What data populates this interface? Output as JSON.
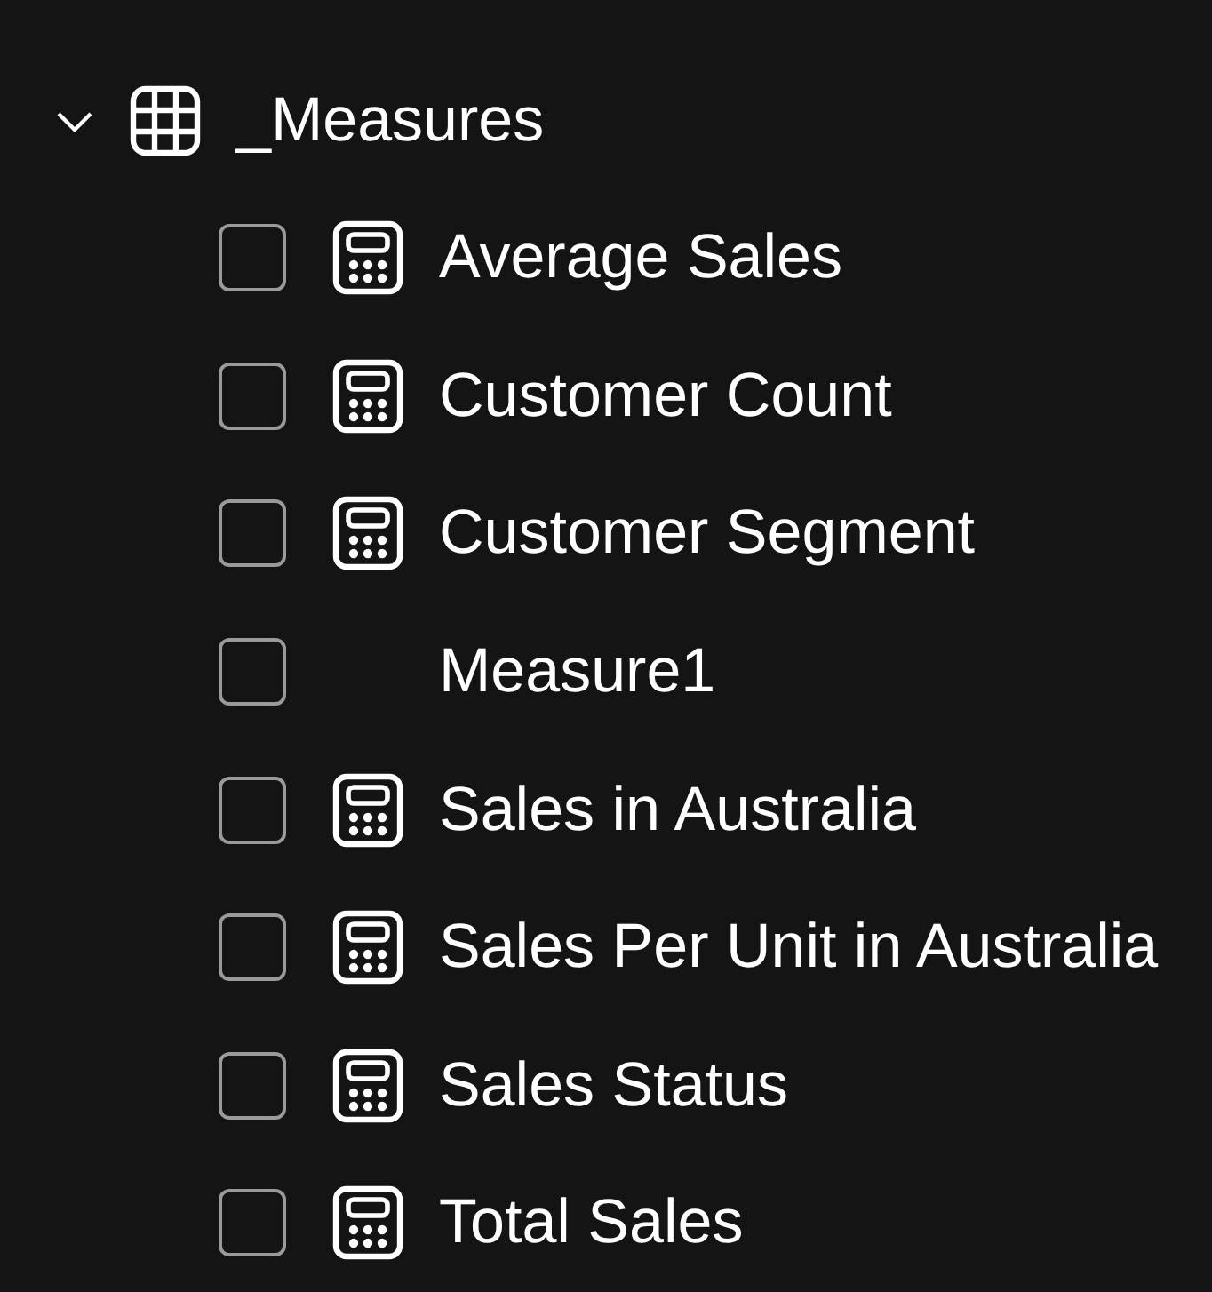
{
  "table": {
    "name": "_Measures",
    "expanded": true,
    "children": [
      {
        "label": "Average Sales",
        "kind": "measure",
        "checked": false
      },
      {
        "label": "Customer Count",
        "kind": "measure",
        "checked": false
      },
      {
        "label": "Customer Segment",
        "kind": "measure",
        "checked": false
      },
      {
        "label": "Measure1",
        "kind": "plain",
        "checked": false
      },
      {
        "label": "Sales in Australia",
        "kind": "measure",
        "checked": false
      },
      {
        "label": "Sales Per Unit in Australia",
        "kind": "measure",
        "checked": false
      },
      {
        "label": "Sales Status",
        "kind": "measure",
        "checked": false
      },
      {
        "label": "Total Sales",
        "kind": "measure",
        "checked": false
      }
    ]
  }
}
